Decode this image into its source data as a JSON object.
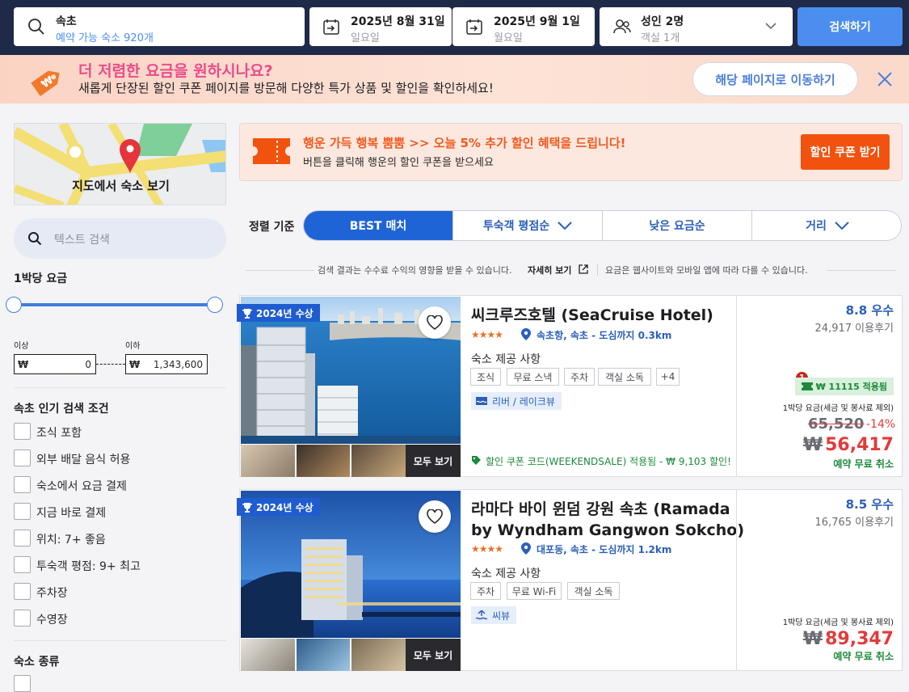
{
  "search": {
    "destination": "속초",
    "destination_sub": "예약 가능 숙소 920개",
    "checkin_date": "2025년 8월 31일",
    "checkin_day": "일요일",
    "checkout_date": "2025년 9월 1일",
    "checkout_day": "월요일",
    "guests": "성인 2명",
    "rooms": "객실 1개",
    "button": "검색하기"
  },
  "promo": {
    "title": "더 저렴한 요금을 원하시나요?",
    "subtitle": "새롭게 단장된 할인 쿠폰 페이지를 방문해 다양한 특가 상품 및 할인을 확인하세요!",
    "button": "해당 페이지로 이동하기"
  },
  "sidebar": {
    "map_label": "지도에서 숙소 보기",
    "text_search_placeholder": "텍스트 검색",
    "price_heading": "1박당 요금",
    "min_label": "이상",
    "max_label": "이하",
    "currency": "₩",
    "min_value": "0",
    "max_value": "1,343,600",
    "popular_heading": "속초 인기 검색 조건",
    "filters": [
      "조식 포함",
      "외부 배달 음식 허용",
      "숙소에서 요금 결제",
      "지금 바로 결제",
      "위치: 7+ 좋음",
      "투숙객 평점: 9+ 최고",
      "주차장",
      "수영장"
    ],
    "type_heading": "숙소 종류"
  },
  "coupon": {
    "title": "행운 가득 행복 뿜뿜 >> 오늘 5% 추가 할인 혜택을 드립니다!",
    "subtitle": "버튼을 클릭해 행운의 할인 쿠폰을 받으세요",
    "button": "할인 쿠폰 받기"
  },
  "sort": {
    "label": "정렬 기준",
    "options": [
      "BEST 매치",
      "투숙객 평점순",
      "낮은 요금순",
      "거리"
    ]
  },
  "notice": {
    "left": "검색 결과는 수수료 수익의 영향을 받을 수 있습니다.",
    "link": "자세히 보기",
    "right": "요금은 웹사이트와 모바일 앱에 따라 다를 수 있습니다."
  },
  "hotels": [
    {
      "award": "2024년 수상",
      "see_all": "모두 보기",
      "name": "씨크루즈호텔 (SeaCruise Hotel)",
      "stars": "★★★★",
      "location": "속초항, 속초 - 도심까지 0.3km",
      "amenities_heading": "숙소 제공 사항",
      "amenities": [
        "조식",
        "무료 스낵",
        "주차",
        "객실 소독",
        "+4"
      ],
      "feature": "리버 / 레이크뷰",
      "promo": "할인 쿠폰 코드(WEEKENDSALE) 적용됨 - ₩ 9,103 할인!",
      "score": "8.8 우수",
      "reviews": "24,917 이용후기",
      "coupon_count": "1",
      "coupon_applied": "₩ 11115 적용됨",
      "price_note": "1박당 요금(세금 및 봉사료 제외)",
      "original_price": "65,520",
      "discount": "-14%",
      "currency": "₩",
      "price": "56,417",
      "free_cancel": "예약 무료 취소"
    },
    {
      "award": "2024년 수상",
      "see_all": "모두 보기",
      "name_line1": "라마다 바이 윈덤 강원 속초 (Ramada",
      "name_line2": "by Wyndham Gangwon Sokcho)",
      "stars": "★★★★",
      "location": "대포동, 속초 - 도심까지 1.2km",
      "amenities_heading": "숙소 제공 사항",
      "amenities": [
        "주차",
        "무료 Wi-Fi",
        "객실 소독"
      ],
      "feature": "씨뷰",
      "score": "8.5 우수",
      "reviews": "16,765 이용후기",
      "price_note": "1박당 요금(세금 및 봉사료 제외)",
      "currency": "₩",
      "price": "89,347",
      "free_cancel": "예약 무료 취소"
    }
  ]
}
